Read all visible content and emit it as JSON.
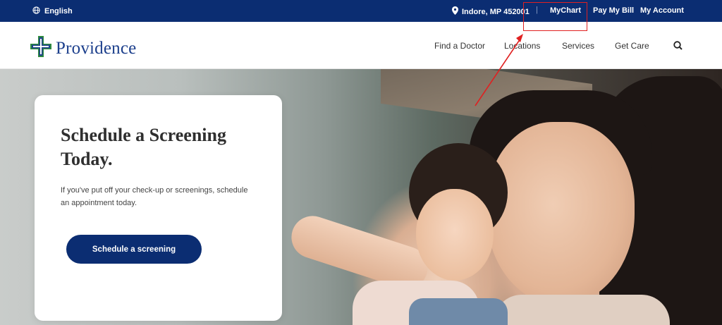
{
  "topbar": {
    "language": "English",
    "location": "Indore, MP 452001",
    "separator": "|",
    "mychart": "MyChart",
    "pay_bill": "Pay My Bill",
    "my_account": "My Account",
    "background_color": "#0b2d72"
  },
  "header": {
    "brand": "Providence",
    "nav": {
      "find_doctor": "Find a Doctor",
      "locations": "Locations",
      "services": "Services",
      "get_care": "Get Care"
    },
    "search_icon": "search-icon"
  },
  "hero": {
    "title": "Schedule a Screening Today.",
    "body": "If you've put off your check-up or screenings, schedule an appointment today.",
    "cta": "Schedule a screening",
    "accent_color": "#0b2d72"
  },
  "icons": {
    "language": "globe-icon",
    "location": "location-pin-icon",
    "logo": "providence-cross-logo",
    "search": "search-icon"
  },
  "annotation_color": "#e02020"
}
